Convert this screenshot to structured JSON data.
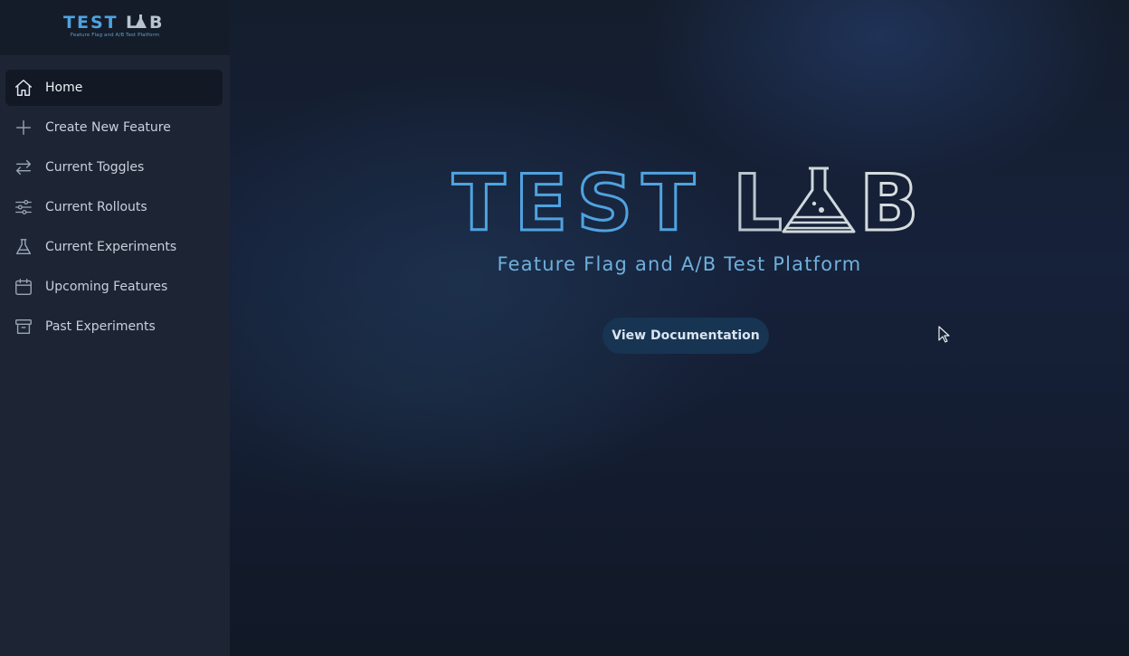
{
  "sidebar": {
    "logo": {
      "title": "TEST LAB",
      "tagline": "Feature Flag and A/B Test Platform"
    },
    "items": [
      {
        "label": "Home",
        "icon": "home-icon",
        "active": true
      },
      {
        "label": "Create New Feature",
        "icon": "plus-icon",
        "active": false
      },
      {
        "label": "Current Toggles",
        "icon": "arrows-swap-icon",
        "active": false
      },
      {
        "label": "Current Rollouts",
        "icon": "sliders-icon",
        "active": false
      },
      {
        "label": "Current Experiments",
        "icon": "flask-icon",
        "active": false
      },
      {
        "label": "Upcoming Features",
        "icon": "calendar-icon",
        "active": false
      },
      {
        "label": "Past Experiments",
        "icon": "archive-icon",
        "active": false
      }
    ]
  },
  "hero": {
    "title": "TEST LAB",
    "subtitle": "Feature Flag and A/B Test Platform",
    "button_label": "View Documentation"
  },
  "colors": {
    "accent_blue": "#4fa3e0",
    "accent_light": "#cfd8dc",
    "sidebar_bg": "#1d2535",
    "button_bg": "#173453"
  }
}
